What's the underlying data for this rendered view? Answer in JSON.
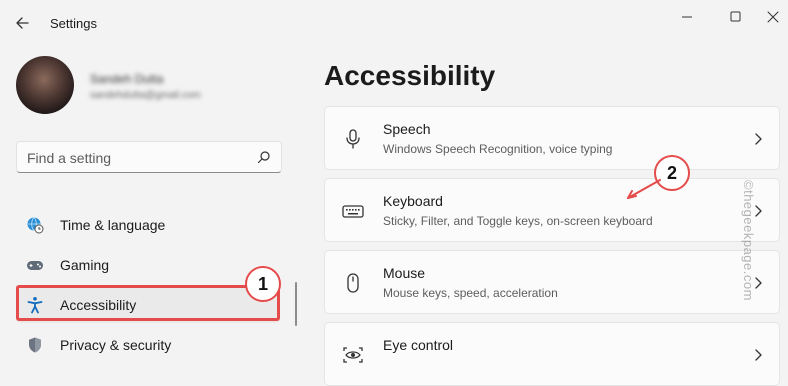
{
  "window": {
    "title": "Settings",
    "controls": [
      "minimize-icon",
      "maximize-icon",
      "close-icon"
    ]
  },
  "user": {
    "name": "Sandeh Dutta",
    "email": "sandehdutta@gmail.com"
  },
  "search": {
    "placeholder": "Find a setting"
  },
  "sidebar": {
    "items": [
      {
        "label": "Time & language",
        "icon": "globe-clock-icon",
        "selected": false
      },
      {
        "label": "Gaming",
        "icon": "gamepad-icon",
        "selected": false
      },
      {
        "label": "Accessibility",
        "icon": "accessibility-icon",
        "selected": true
      },
      {
        "label": "Privacy & security",
        "icon": "shield-icon",
        "selected": false
      }
    ]
  },
  "main": {
    "title": "Accessibility",
    "cards": [
      {
        "title": "Speech",
        "subtitle": "Windows Speech Recognition, voice typing",
        "icon": "microphone-icon"
      },
      {
        "title": "Keyboard",
        "subtitle": "Sticky, Filter, and Toggle keys, on-screen keyboard",
        "icon": "keyboard-icon"
      },
      {
        "title": "Mouse",
        "subtitle": "Mouse keys, speed, acceleration",
        "icon": "mouse-icon"
      },
      {
        "title": "Eye control",
        "subtitle": "",
        "icon": "eye-control-icon"
      }
    ]
  },
  "annotations": {
    "callout_1": "1",
    "callout_2": "2"
  },
  "watermark": "©thegeekpage.com",
  "colors": {
    "accent": "#0067c0",
    "annotation": "#e64b4b",
    "background": "#f3f3f3",
    "card": "#fbfbfb"
  }
}
